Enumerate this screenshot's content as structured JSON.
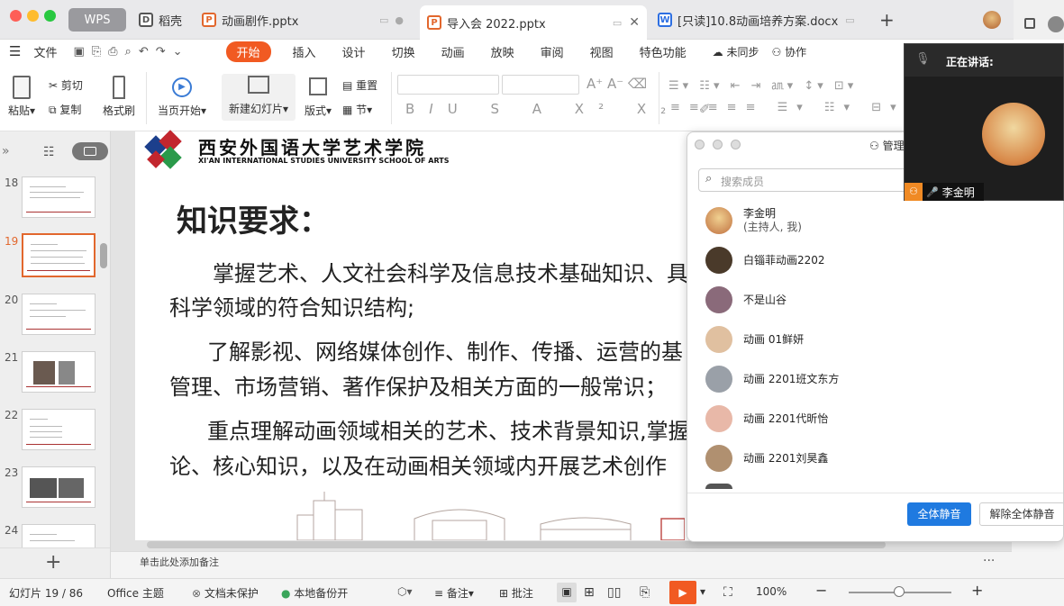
{
  "tabs": [
    {
      "label": "WPS",
      "type": "home"
    },
    {
      "label": "稻壳",
      "type": "docer"
    },
    {
      "label": "动画剧作.pptx",
      "type": "ppt"
    },
    {
      "label": "导入会 2022.pptx",
      "type": "ppt",
      "active": true
    },
    {
      "label": "[只读]10.8动画培养方案.docx",
      "type": "doc"
    }
  ],
  "menu": {
    "file": "文件",
    "items": [
      "开始",
      "插入",
      "设计",
      "切换",
      "动画",
      "放映",
      "审阅",
      "视图",
      "特色功能"
    ],
    "sync": "未同步",
    "collab": "协作"
  },
  "ribbon": {
    "paste": "粘贴",
    "cut": "剪切",
    "copy": "复制",
    "format_painter": "格式刷",
    "from_current": "当页开始",
    "new_slide": "新建幻灯片",
    "layout": "版式",
    "reset": "重置",
    "section": "节"
  },
  "thumbnails": [
    "18",
    "19",
    "20",
    "21",
    "22",
    "23",
    "24"
  ],
  "slide": {
    "school_cn": "西安外国语大学艺术学院",
    "school_en": "XI'AN INTERNATIONAL STUDIES UNIVERSITY SCHOOL OF ARTS",
    "heading": "知识要求：",
    "lines": [
      "掌握艺术、人文社会科学及信息技术基础知识、具",
      "科学领域的符合知识结构;",
      "了解影视、网络媒体创作、制作、传播、运营的基",
      "管理、市场营销、著作保护及相关方面的一般常识；",
      "重点理解动画领域相关的艺术、技术背景知识,掌握",
      "论、核心知识，以及在动画相关领域内开展艺术创作"
    ]
  },
  "notes_placeholder": "单击此处添加备注",
  "status": {
    "slide_count": "幻灯片 19 / 86",
    "theme": "Office 主题",
    "protect": "文档未保护",
    "backup": "本地备份开",
    "notes": "备注",
    "comments": "批注",
    "zoom": "100%"
  },
  "members_panel": {
    "title": "管理",
    "search_placeholder": "搜索成员",
    "members": [
      {
        "name": "李金明",
        "role": "(主持人, 我)",
        "color": "#d8a060"
      },
      {
        "name": "白锱菲动画2202",
        "color": "#4a3a2a"
      },
      {
        "name": "不是山谷",
        "color": "#8a6a7a"
      },
      {
        "name": "动画 01鲜妍",
        "color": "#e0c0a0"
      },
      {
        "name": "动画 2201班文东方",
        "color": "#9aa0a8"
      },
      {
        "name": "动画 2201代昕怡",
        "color": "#e8b8a8"
      },
      {
        "name": "动画 2201刘昊鑫",
        "color": "#b09070"
      }
    ],
    "mute_all": "全体静音",
    "unmute_all": "解除全体静音"
  },
  "speaker": {
    "label": "正在讲话:",
    "name": "李金明"
  }
}
